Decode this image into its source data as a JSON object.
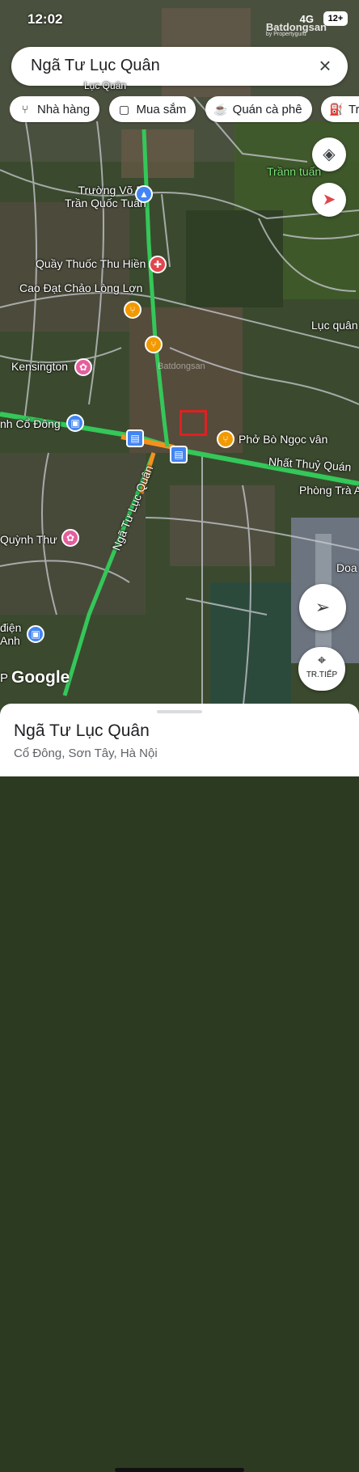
{
  "status_bar": {
    "time": "12:02",
    "network": "4G",
    "battery": "12+"
  },
  "watermark_top": {
    "brand": "Batdongsan",
    "sub": "by Propertyguru"
  },
  "watermark_map": "Batdongsan",
  "search": {
    "query": "Ngã Tư Lục Quân",
    "close_icon": "×"
  },
  "chips": [
    {
      "icon": "fork-knife-icon",
      "label": "Nhà hàng"
    },
    {
      "icon": "shopping-bag-icon",
      "label": "Mua sắm"
    },
    {
      "icon": "coffee-cup-icon",
      "label": "Quán cà phê"
    },
    {
      "icon": "fuel-pump-icon",
      "label": "Trạ"
    }
  ],
  "map_labels": {
    "truong_vo_bi": "Trường Võ Bị\nTrần Quốc Tuấn",
    "trann_tuan": "Trầnn tuấn",
    "quay_thuoc": "Quầy Thuốc Thu Hiền",
    "cao_dat": "Cao Đạt Chảo Lòng Lợn",
    "luc_quan": "Lục quân",
    "kensington": "Kensington",
    "co_dong": "nh Cổ Đông",
    "pho_bo": "Phở Bò Ngọc vân",
    "nhat_thuy_quan": "Nhất Thuỷ Quán",
    "phong_tra": "Phòng Trà A",
    "quynh_thu": "Quỳnh Thư",
    "dien_anh": "điện\nAnh",
    "doa": "Doa",
    "top_partial": "Lục Quân",
    "road_luc_quan": "Ngã Tư Lục Quân",
    "google": "Google",
    "p_partial": "P"
  },
  "start_button": {
    "label": "TR.TIẾP"
  },
  "place": {
    "title": "Ngã Tư Lục Quân",
    "address": "Cổ Đông, Sơn Tây, Hà Nội"
  },
  "colors": {
    "traffic_green": "#34c759",
    "traffic_orange": "#f5901e",
    "pin_red": "#e0464e",
    "pin_orange": "#f29900",
    "pin_blue": "#4285f4",
    "pin_pink": "#e55e9c"
  }
}
